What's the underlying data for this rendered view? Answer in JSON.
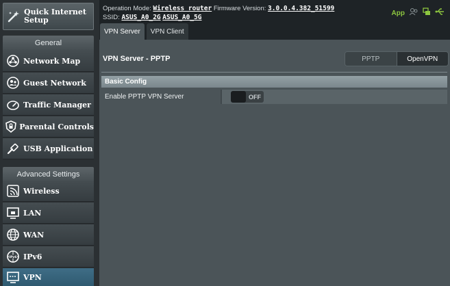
{
  "sidebar": {
    "quick_setup": {
      "label_line1": "Quick Internet",
      "label_line2": "Setup",
      "icon": "wand-icon"
    },
    "general_header": "General",
    "general_items": [
      {
        "label": "Network Map",
        "icon": "network-map-icon"
      },
      {
        "label": "Guest Network",
        "icon": "guest-network-icon"
      },
      {
        "label": "Traffic Manager",
        "icon": "gauge-icon"
      },
      {
        "label": "Parental Controls",
        "icon": "shield-lock-icon"
      },
      {
        "label": "USB Application",
        "icon": "usb-icon"
      }
    ],
    "advanced_header": "Advanced Settings",
    "advanced_items": [
      {
        "label": "Wireless",
        "icon": "wireless-icon"
      },
      {
        "label": "LAN",
        "icon": "lan-icon"
      },
      {
        "label": "WAN",
        "icon": "globe-icon"
      },
      {
        "label": "IPv6",
        "icon": "ipv6-icon"
      },
      {
        "label": "VPN",
        "icon": "vpn-icon"
      }
    ]
  },
  "topbar": {
    "op_mode_label": "Operation Mode:",
    "op_mode_value": "Wireless router",
    "firmware_label": "Firmware Version:",
    "firmware_value": "3.0.0.4.382_51599",
    "ssid_label": "SSID:",
    "ssid_2g": "ASUS_A0_2G",
    "ssid_5g": "ASUS_A0_5G",
    "app_label": "App",
    "status_icons": [
      "user-icon",
      "devices-icon",
      "usb-status-icon"
    ]
  },
  "tabs": [
    {
      "label": "VPN Server"
    },
    {
      "label": "VPN Client"
    }
  ],
  "main": {
    "title": "VPN Server - PPTP",
    "mode_options": [
      {
        "label": "PPTP"
      },
      {
        "label": "OpenVPN"
      }
    ],
    "section_title": "Basic Config",
    "rows": [
      {
        "label": "Enable PPTP VPN Server",
        "toggle_state": "OFF"
      }
    ]
  },
  "colors": {
    "accent_green": "#8dc63f",
    "active_item": "#3f6d86",
    "panel_bg": "#4b5458"
  }
}
